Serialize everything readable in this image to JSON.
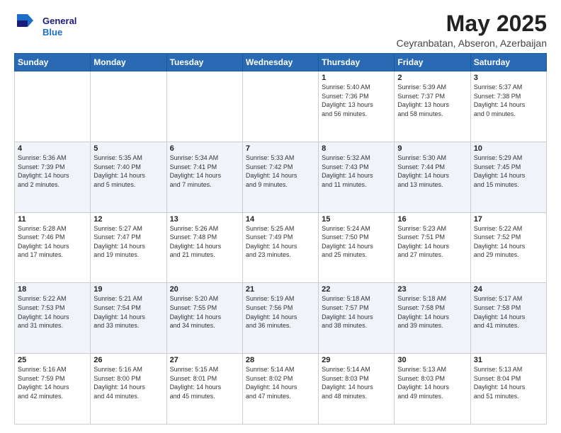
{
  "logo": {
    "line1": "General",
    "line2": "Blue",
    "icon_color": "#2a6ab5"
  },
  "header": {
    "title": "May 2025",
    "subtitle": "Ceyranbatan, Abseron, Azerbaijan"
  },
  "weekdays": [
    "Sunday",
    "Monday",
    "Tuesday",
    "Wednesday",
    "Thursday",
    "Friday",
    "Saturday"
  ],
  "weeks": [
    [
      {
        "day": "",
        "info": ""
      },
      {
        "day": "",
        "info": ""
      },
      {
        "day": "",
        "info": ""
      },
      {
        "day": "",
        "info": ""
      },
      {
        "day": "1",
        "info": "Sunrise: 5:40 AM\nSunset: 7:36 PM\nDaylight: 13 hours\nand 56 minutes."
      },
      {
        "day": "2",
        "info": "Sunrise: 5:39 AM\nSunset: 7:37 PM\nDaylight: 13 hours\nand 58 minutes."
      },
      {
        "day": "3",
        "info": "Sunrise: 5:37 AM\nSunset: 7:38 PM\nDaylight: 14 hours\nand 0 minutes."
      }
    ],
    [
      {
        "day": "4",
        "info": "Sunrise: 5:36 AM\nSunset: 7:39 PM\nDaylight: 14 hours\nand 2 minutes."
      },
      {
        "day": "5",
        "info": "Sunrise: 5:35 AM\nSunset: 7:40 PM\nDaylight: 14 hours\nand 5 minutes."
      },
      {
        "day": "6",
        "info": "Sunrise: 5:34 AM\nSunset: 7:41 PM\nDaylight: 14 hours\nand 7 minutes."
      },
      {
        "day": "7",
        "info": "Sunrise: 5:33 AM\nSunset: 7:42 PM\nDaylight: 14 hours\nand 9 minutes."
      },
      {
        "day": "8",
        "info": "Sunrise: 5:32 AM\nSunset: 7:43 PM\nDaylight: 14 hours\nand 11 minutes."
      },
      {
        "day": "9",
        "info": "Sunrise: 5:30 AM\nSunset: 7:44 PM\nDaylight: 14 hours\nand 13 minutes."
      },
      {
        "day": "10",
        "info": "Sunrise: 5:29 AM\nSunset: 7:45 PM\nDaylight: 14 hours\nand 15 minutes."
      }
    ],
    [
      {
        "day": "11",
        "info": "Sunrise: 5:28 AM\nSunset: 7:46 PM\nDaylight: 14 hours\nand 17 minutes."
      },
      {
        "day": "12",
        "info": "Sunrise: 5:27 AM\nSunset: 7:47 PM\nDaylight: 14 hours\nand 19 minutes."
      },
      {
        "day": "13",
        "info": "Sunrise: 5:26 AM\nSunset: 7:48 PM\nDaylight: 14 hours\nand 21 minutes."
      },
      {
        "day": "14",
        "info": "Sunrise: 5:25 AM\nSunset: 7:49 PM\nDaylight: 14 hours\nand 23 minutes."
      },
      {
        "day": "15",
        "info": "Sunrise: 5:24 AM\nSunset: 7:50 PM\nDaylight: 14 hours\nand 25 minutes."
      },
      {
        "day": "16",
        "info": "Sunrise: 5:23 AM\nSunset: 7:51 PM\nDaylight: 14 hours\nand 27 minutes."
      },
      {
        "day": "17",
        "info": "Sunrise: 5:22 AM\nSunset: 7:52 PM\nDaylight: 14 hours\nand 29 minutes."
      }
    ],
    [
      {
        "day": "18",
        "info": "Sunrise: 5:22 AM\nSunset: 7:53 PM\nDaylight: 14 hours\nand 31 minutes."
      },
      {
        "day": "19",
        "info": "Sunrise: 5:21 AM\nSunset: 7:54 PM\nDaylight: 14 hours\nand 33 minutes."
      },
      {
        "day": "20",
        "info": "Sunrise: 5:20 AM\nSunset: 7:55 PM\nDaylight: 14 hours\nand 34 minutes."
      },
      {
        "day": "21",
        "info": "Sunrise: 5:19 AM\nSunset: 7:56 PM\nDaylight: 14 hours\nand 36 minutes."
      },
      {
        "day": "22",
        "info": "Sunrise: 5:18 AM\nSunset: 7:57 PM\nDaylight: 14 hours\nand 38 minutes."
      },
      {
        "day": "23",
        "info": "Sunrise: 5:18 AM\nSunset: 7:58 PM\nDaylight: 14 hours\nand 39 minutes."
      },
      {
        "day": "24",
        "info": "Sunrise: 5:17 AM\nSunset: 7:58 PM\nDaylight: 14 hours\nand 41 minutes."
      }
    ],
    [
      {
        "day": "25",
        "info": "Sunrise: 5:16 AM\nSunset: 7:59 PM\nDaylight: 14 hours\nand 42 minutes."
      },
      {
        "day": "26",
        "info": "Sunrise: 5:16 AM\nSunset: 8:00 PM\nDaylight: 14 hours\nand 44 minutes."
      },
      {
        "day": "27",
        "info": "Sunrise: 5:15 AM\nSunset: 8:01 PM\nDaylight: 14 hours\nand 45 minutes."
      },
      {
        "day": "28",
        "info": "Sunrise: 5:14 AM\nSunset: 8:02 PM\nDaylight: 14 hours\nand 47 minutes."
      },
      {
        "day": "29",
        "info": "Sunrise: 5:14 AM\nSunset: 8:03 PM\nDaylight: 14 hours\nand 48 minutes."
      },
      {
        "day": "30",
        "info": "Sunrise: 5:13 AM\nSunset: 8:03 PM\nDaylight: 14 hours\nand 49 minutes."
      },
      {
        "day": "31",
        "info": "Sunrise: 5:13 AM\nSunset: 8:04 PM\nDaylight: 14 hours\nand 51 minutes."
      }
    ]
  ]
}
